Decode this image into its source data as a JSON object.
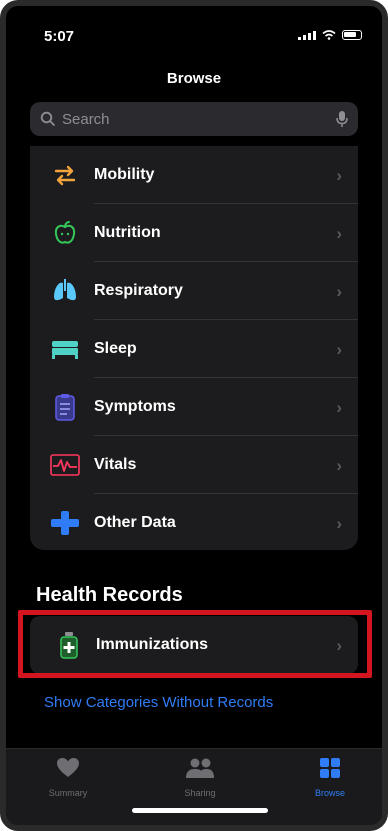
{
  "status": {
    "time": "5:07"
  },
  "nav": {
    "title": "Browse"
  },
  "search": {
    "placeholder": "Search"
  },
  "categories": [
    {
      "label": "Mobility",
      "icon": "mobility-arrows-icon",
      "color": "#f1a33c"
    },
    {
      "label": "Nutrition",
      "icon": "apple-icon",
      "color": "#34c759"
    },
    {
      "label": "Respiratory",
      "icon": "lungs-icon",
      "color": "#5ac8fa"
    },
    {
      "label": "Sleep",
      "icon": "bed-icon",
      "color": "#4fd1c5"
    },
    {
      "label": "Symptoms",
      "icon": "clipboard-icon",
      "color": "#5e5ce6"
    },
    {
      "label": "Vitals",
      "icon": "heart-rate-icon",
      "color": "#ff375f"
    },
    {
      "label": "Other Data",
      "icon": "plus-icon",
      "color": "#2f7cf6"
    }
  ],
  "health_records": {
    "title": "Health Records",
    "items": [
      {
        "label": "Immunizations",
        "icon": "vaccine-icon",
        "color": "#34c759"
      }
    ],
    "show_link": "Show Categories Without Records"
  },
  "tabs": [
    {
      "label": "Summary",
      "icon": "heart-icon",
      "active": false
    },
    {
      "label": "Sharing",
      "icon": "people-icon",
      "active": false
    },
    {
      "label": "Browse",
      "icon": "grid-icon",
      "active": true
    }
  ],
  "colors": {
    "accent": "#2f7cf6",
    "highlight": "#d2151f",
    "background": "#000000",
    "card": "#1c1c1e"
  }
}
